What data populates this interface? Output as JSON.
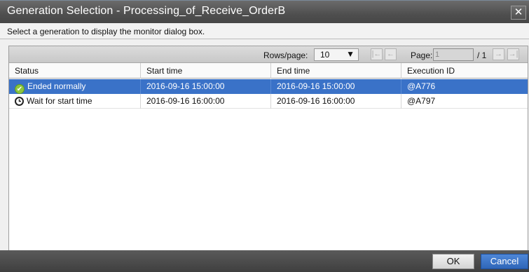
{
  "window": {
    "title": "Generation Selection - Processing_of_Receive_OrderB",
    "close_label": "✕"
  },
  "instruction": "Select a generation to display the monitor dialog box.",
  "pager": {
    "rows_label": "Rows/page:",
    "rows_value": "10",
    "page_label": "Page:",
    "page_value": "1",
    "page_total": "/ 1"
  },
  "table": {
    "columns": [
      "Status",
      "Start time",
      "End time",
      "Execution ID"
    ],
    "rows": [
      {
        "status": "Ended normally",
        "status_icon": "check-circle-icon",
        "start": "2016-09-16 15:00:00",
        "end": "2016-09-16 15:00:00",
        "id": "@A776",
        "selected": true
      },
      {
        "status": "Wait for start time",
        "status_icon": "clock-icon",
        "start": "2016-09-16 16:00:00",
        "end": "2016-09-16 16:00:00",
        "id": "@A797",
        "selected": false
      }
    ]
  },
  "buttons": {
    "ok": "OK",
    "cancel": "Cancel"
  },
  "colors": {
    "selection": "#3a72c8",
    "accent_button": "#2f66b8",
    "ok_status": "#8cc63f"
  }
}
